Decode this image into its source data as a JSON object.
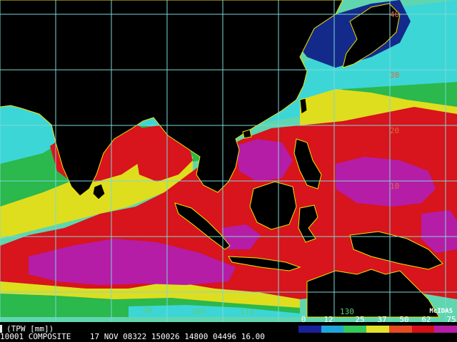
{
  "product": {
    "units_label": "(TPW [mm])",
    "status_line": "10001 COMPOSITE    17 NOV 08322 150026 14800 04496 16.00",
    "producer": "McIDAS"
  },
  "legend": {
    "ticks": [
      "0",
      "12",
      "25",
      "37",
      "50",
      "62",
      "75"
    ],
    "colors": [
      "#1a1f9a",
      "#1ea6d8",
      "#35c85a",
      "#e3e22a",
      "#e64a22",
      "#d40f1a",
      "#b51da6"
    ]
  },
  "grid": {
    "lat_labels": [
      "40",
      "30",
      "20",
      "10"
    ],
    "lon_labels": [
      "90",
      "100",
      "110",
      "130"
    ],
    "grid_color": "#7ad8d8"
  },
  "colors": {
    "land": "#000000",
    "coast": "#f2e400",
    "low_water_navy": "#142a8a",
    "low_water_cyan": "#3dd6d6",
    "mid_water_green": "#2bb84d",
    "mid_water_yellow": "#dede1e",
    "high_water_red": "#d8141c",
    "max_water_magenta": "#b51da6"
  }
}
